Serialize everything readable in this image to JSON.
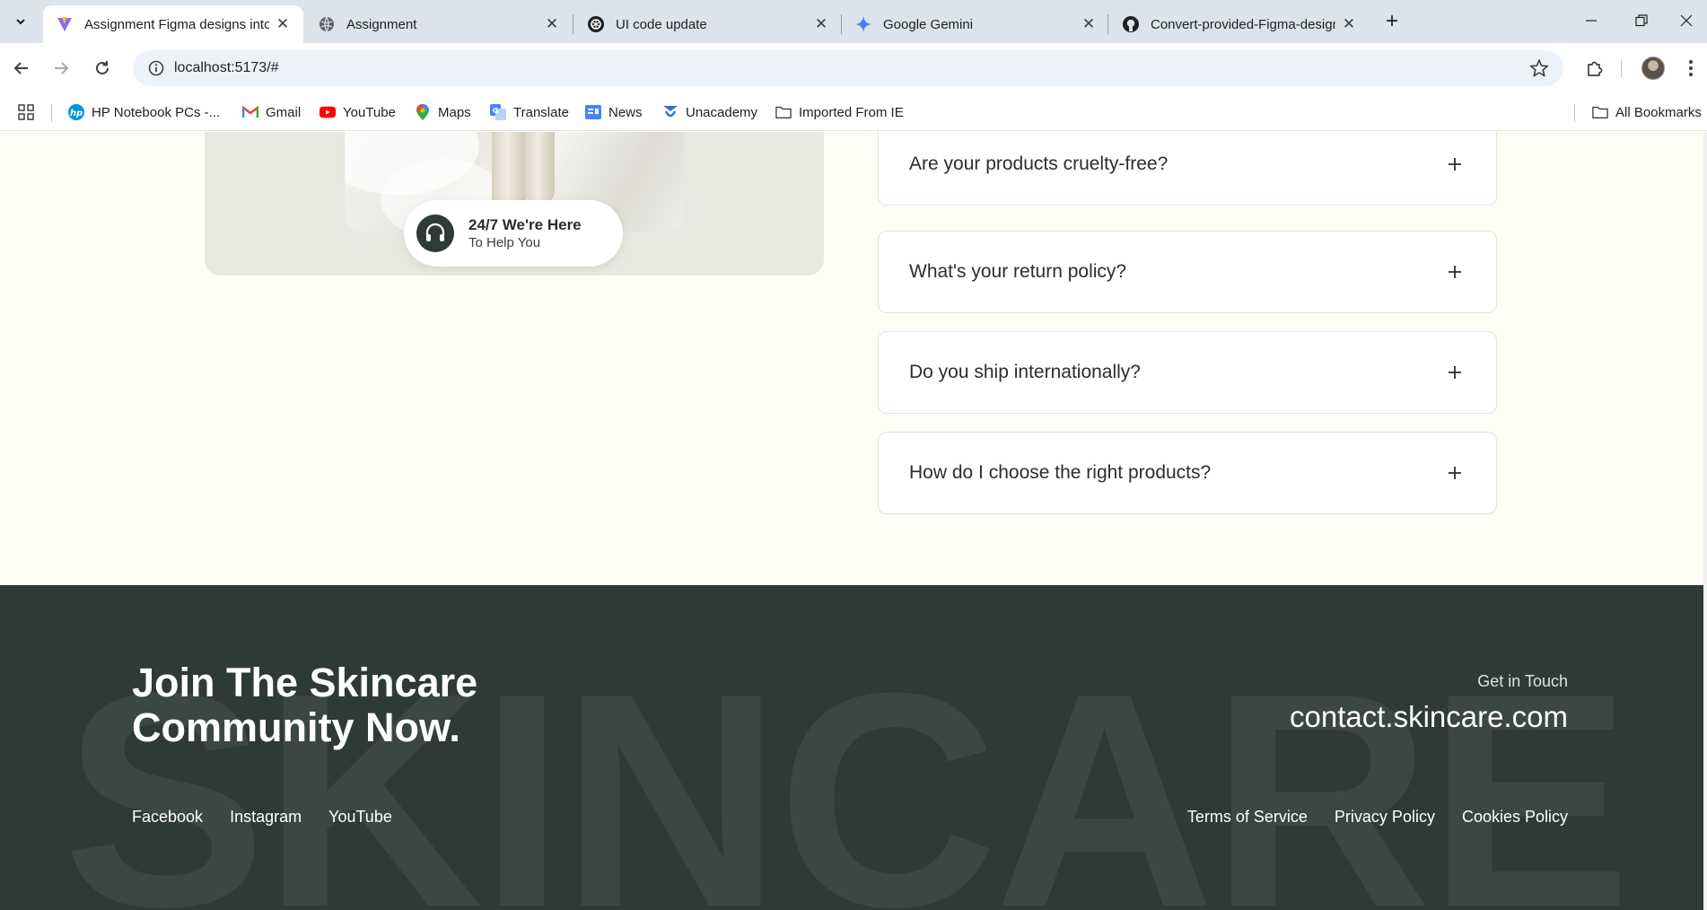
{
  "browser": {
    "tabs": [
      {
        "title": "Assignment Figma designs into",
        "active": true,
        "favicon": "vite-icon"
      },
      {
        "title": "Assignment",
        "active": false,
        "favicon": "globe-icon"
      },
      {
        "title": "UI code update",
        "active": false,
        "favicon": "openai-icon"
      },
      {
        "title": "Google Gemini",
        "active": false,
        "favicon": "gemini-icon"
      },
      {
        "title": "Convert-provided-Figma-design",
        "active": false,
        "favicon": "github-icon"
      }
    ],
    "url": "localhost:5173/#",
    "bookmarks": [
      {
        "label": "HP Notebook PCs -...",
        "icon": "hp-icon"
      },
      {
        "label": "Gmail",
        "icon": "gmail-icon"
      },
      {
        "label": "YouTube",
        "icon": "youtube-icon"
      },
      {
        "label": "Maps",
        "icon": "maps-icon"
      },
      {
        "label": "Translate",
        "icon": "translate-icon"
      },
      {
        "label": "News",
        "icon": "news-icon"
      },
      {
        "label": "Unacademy",
        "icon": "unacademy-icon"
      },
      {
        "label": "Imported From IE",
        "icon": "folder-icon"
      }
    ],
    "all_bookmarks": "All Bookmarks"
  },
  "support": {
    "title": "24/7 We're Here",
    "subtitle": "To Help You"
  },
  "faq": [
    {
      "question": "Are your products cruelty-free?"
    },
    {
      "question": "What's your return policy?"
    },
    {
      "question": "Do you ship internationally?"
    },
    {
      "question": "How do I choose the right products?"
    }
  ],
  "footer": {
    "headline": "Join The Skincare Community Now.",
    "get_in_touch": "Get in Touch",
    "email": "contact.skincare.com",
    "social": [
      "Facebook",
      "Instagram",
      "YouTube"
    ],
    "legal": [
      "Terms of Service",
      "Privacy Policy",
      "Cookies Policy"
    ],
    "watermark": "SKINCARE"
  },
  "colors": {
    "page_bg": "#fefef6",
    "footer_bg": "#2e3a36",
    "accent_dark": "#2e3b37"
  }
}
